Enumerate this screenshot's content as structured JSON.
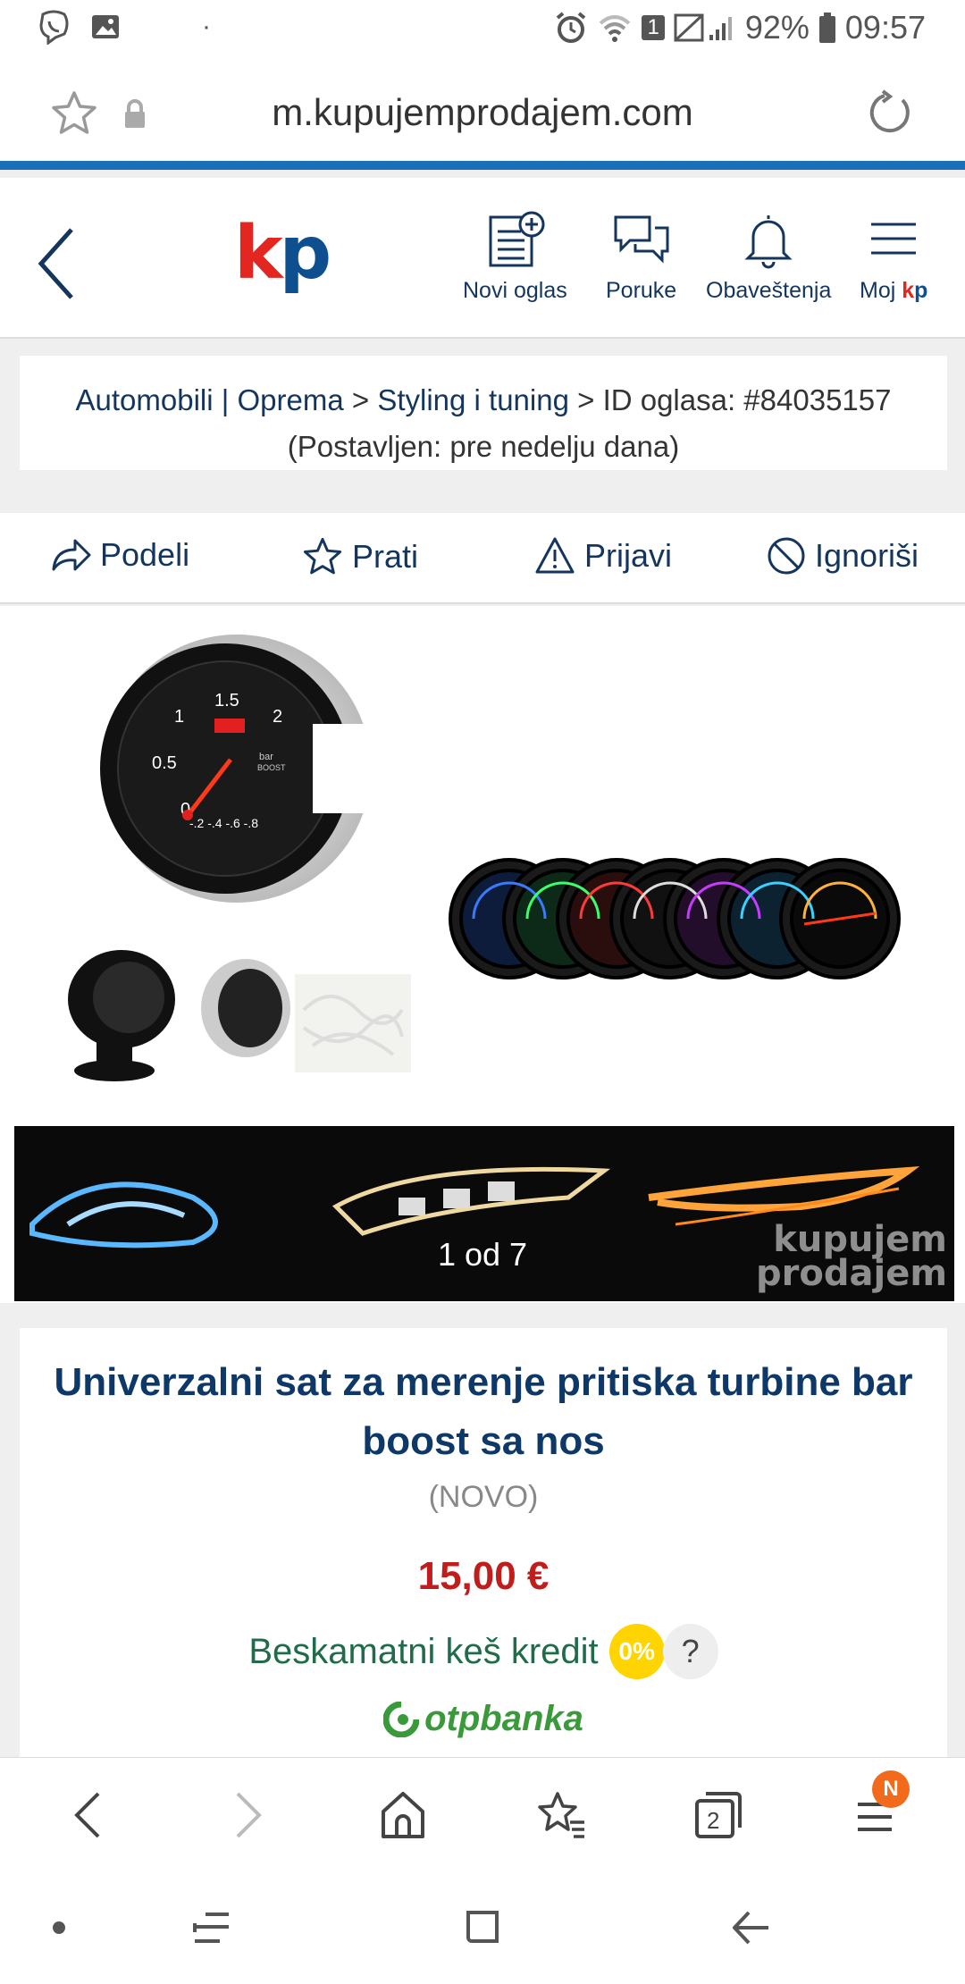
{
  "status_bar": {
    "battery": "92%",
    "time": "09:57",
    "sim_badge": "1"
  },
  "browser": {
    "url": "m.kupujemprodajem.com",
    "tab_count": "2",
    "menu_badge": "N"
  },
  "site_header": {
    "logo_k": "k",
    "logo_p": "p",
    "nav": {
      "new_ad": "Novi oglas",
      "messages": "Poruke",
      "notifications": "Obaveštenja",
      "my_kp_prefix": "Moj ",
      "my_kp_k": "k",
      "my_kp_p": "p"
    }
  },
  "breadcrumb": {
    "category": "Automobili | Oprema",
    "sep1": " > ",
    "subcategory": "Styling i tuning",
    "sep2": " > ",
    "ad_id": "ID oglasa: #84035157",
    "posted": "(Postavljen: pre nedelju dana)"
  },
  "actions": {
    "share": "Podeli",
    "follow": "Prati",
    "report": "Prijavi",
    "ignore": "Ignoriši"
  },
  "gallery": {
    "counter": "1 od 7",
    "watermark_line1": "kupujem",
    "watermark_line2": "prodajem",
    "gauge_labels": {
      "g15": "1.5",
      "g1": "1",
      "g2": "2",
      "g05": "0.5",
      "g0": "0",
      "bar": "bar",
      "boost": "BOOST",
      "neg": "-.2 -.4 -.6 -.8"
    }
  },
  "listing": {
    "title": "Univerzalni sat za merenje pritiska turbine bar boost sa nos",
    "condition": "(NOVO)",
    "price": "15,00 €",
    "credit_text": "Beskamatni keš kredit",
    "credit_badge": "0%",
    "help": "?",
    "bank": "otpbanka"
  },
  "colors": {
    "brand_red": "#e3261f",
    "brand_blue": "#0d4f8f",
    "price_red": "#c01d1d",
    "accent_blue": "#1a6fb8"
  }
}
